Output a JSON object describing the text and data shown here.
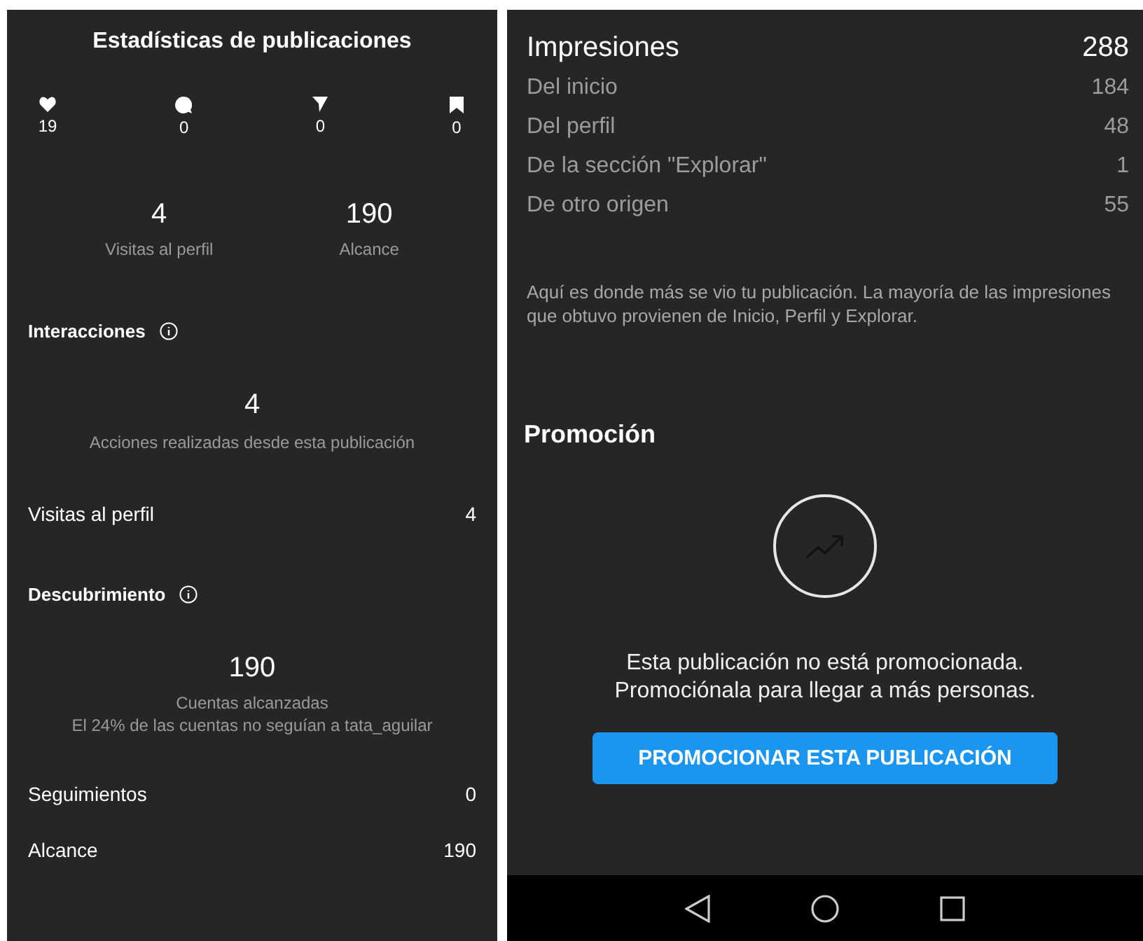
{
  "left_screen": {
    "title": "Estadísticas de publicaciones",
    "engagement": [
      {
        "kind": "likes",
        "count": "19"
      },
      {
        "kind": "comments",
        "count": "0"
      },
      {
        "kind": "shares",
        "count": "0"
      },
      {
        "kind": "saves",
        "count": "0"
      }
    ],
    "summary": [
      {
        "value": "4",
        "label": "Visitas al perfil"
      },
      {
        "value": "190",
        "label": "Alcance"
      }
    ],
    "interactions": {
      "heading": "Interacciones",
      "value": "4",
      "caption": "Acciones realizadas desde esta publicación",
      "rows": [
        {
          "label": "Visitas al perfil",
          "value": "4"
        }
      ]
    },
    "discovery": {
      "heading": "Descubrimiento",
      "value": "190",
      "caption": "Cuentas alcanzadas",
      "note": "El 24% de las cuentas no seguían a tata_aguilar",
      "rows": [
        {
          "label": "Seguimientos",
          "value": "0"
        },
        {
          "label": "Alcance",
          "value": "190"
        }
      ]
    }
  },
  "right_screen": {
    "impressions": {
      "label": "Impresiones",
      "value": "288",
      "rows": [
        {
          "label": "Del inicio",
          "value": "184"
        },
        {
          "label": "Del perfil",
          "value": "48"
        },
        {
          "label": "De la sección \"Explorar\"",
          "value": "1"
        },
        {
          "label": "De otro origen",
          "value": "55"
        }
      ],
      "note": "Aquí es donde más se vio tu publicación. La mayoría de las impresiones que obtuvo provienen de Inicio, Perfil y Explorar."
    },
    "promotion": {
      "heading": "Promoción",
      "message_lines": [
        "Esta publicación no está promocionada.",
        "Promociónala para llegar a más personas."
      ],
      "button": "PROMOCIONAR ESTA PUBLICACIÓN"
    },
    "nav_bar": [
      {
        "kind": "back"
      },
      {
        "kind": "home"
      },
      {
        "kind": "recents"
      }
    ]
  }
}
